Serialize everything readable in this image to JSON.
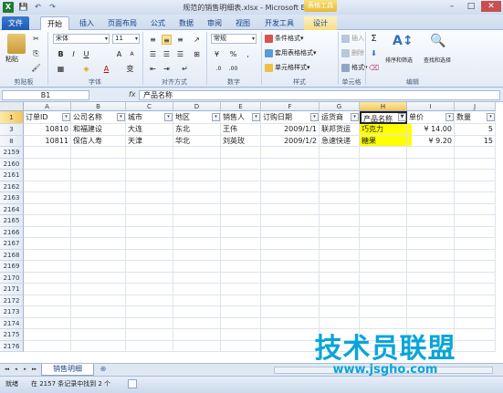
{
  "window": {
    "title": "规范的销售明细表.xlsx - Microsoft Excel",
    "context_tab_title": "表格工具",
    "app_icon": "X"
  },
  "quick_access": {
    "save_icon": "💾",
    "undo_icon": "↶",
    "redo_icon": "↷"
  },
  "window_controls": {
    "minimize": "–",
    "maximize": "□",
    "close": "✕"
  },
  "tabs": [
    "文件",
    "开始",
    "插入",
    "页面布局",
    "公式",
    "数据",
    "审阅",
    "视图",
    "开发工具",
    "设计"
  ],
  "ribbon": {
    "clipboard": {
      "paste": "粘贴",
      "group": "剪贴板"
    },
    "font": {
      "name": "宋体",
      "size": "11",
      "bold": "B",
      "italic": "I",
      "underline": "U",
      "grow": "A",
      "shrink": "A",
      "color_a": "A",
      "wen": "变",
      "group": "字体"
    },
    "align": {
      "group": "对齐方式"
    },
    "number": {
      "format": "常规",
      "pct": "%",
      "comma": ",",
      "group": "数字"
    },
    "styles": {
      "cond": "条件格式",
      "table": "套用表格格式",
      "cell": "单元格样式",
      "group": "样式"
    },
    "cells": {
      "insert": "插入",
      "delete": "删除",
      "format": "格式",
      "group": "单元格"
    },
    "edit": {
      "sum": "Σ",
      "sort": "排序和筛选",
      "find": "查找和选择",
      "group": "编辑"
    }
  },
  "formula_bar": {
    "name_box": "B1",
    "fx": "fx",
    "content": "产品名称"
  },
  "columns": [
    "A",
    "B",
    "C",
    "D",
    "E",
    "F",
    "G",
    "H",
    "I",
    "J"
  ],
  "header_row": {
    "row": "1",
    "cells": [
      "订单ID",
      "公司名称",
      "城市",
      "地区",
      "销售人",
      "订购日期",
      "运货商",
      "产品名称",
      "单价",
      "数量"
    ]
  },
  "rows": [
    {
      "row": "3",
      "cells": [
        "10810",
        "和福建设",
        "大连",
        "东北",
        "王伟",
        "2009/1/1",
        "联邦货运",
        "巧克力",
        "¥ 14.00",
        "5"
      ]
    },
    {
      "row": "8",
      "cells": [
        "10811",
        "保信人寿",
        "天津",
        "华北",
        "刘英玫",
        "2009/1/2",
        "急速快递",
        "糖果",
        "¥ 9.20",
        "15"
      ]
    }
  ],
  "empty_rows": [
    "2159",
    "2160",
    "2161",
    "2162",
    "2163",
    "2164",
    "2165",
    "2166",
    "2167",
    "2168",
    "2169",
    "2170",
    "2171",
    "2172",
    "2173",
    "2174",
    "2175",
    "2176"
  ],
  "sheet_tab": "销售明细",
  "sheet_nav": [
    "◂◂",
    "◂",
    "▸",
    "▸▸"
  ],
  "status": {
    "mode": "就绪",
    "message": "在 2157 条记录中找到 2 个"
  },
  "watermark": {
    "text": "技术员联盟",
    "url": "www.jsgho.com"
  },
  "colors": {
    "highlight": "#ffff00",
    "accent": "#1d5bb4",
    "watermark": "#0aa5d8"
  }
}
